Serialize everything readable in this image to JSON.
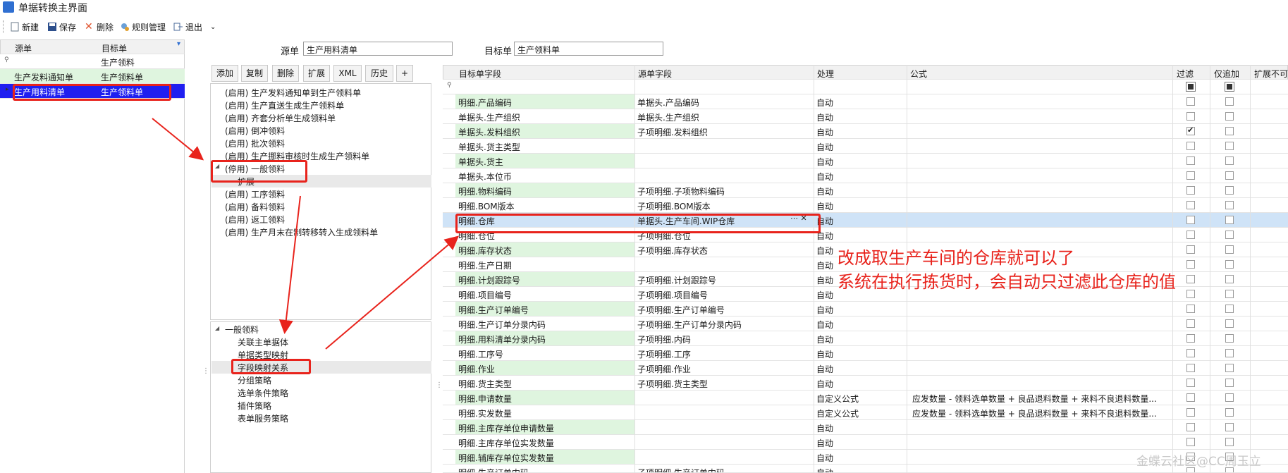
{
  "window": {
    "title": "单据转换主界面"
  },
  "toolbar": {
    "new": "新建",
    "save": "保存",
    "delete": "删除",
    "rules": "规则管理",
    "exit": "退出"
  },
  "left_grid": {
    "headers": [
      "源单",
      "目标单"
    ],
    "filter_target": "生产领料",
    "rows": [
      {
        "source": "生产发料通知单",
        "target": "生产领料单"
      },
      {
        "source": "生产用料清单",
        "target": "生产领料单"
      }
    ]
  },
  "form": {
    "source_label": "源单",
    "source_value": "生产用料清单",
    "target_label": "目标单",
    "target_value": "生产领料单"
  },
  "mid_buttons": [
    "添加",
    "复制",
    "删除",
    "扩展",
    "XML",
    "历史",
    "+"
  ],
  "tree1": [
    "(启用) 生产发料通知单到生产领料单",
    "(启用) 生产直送生成生产领料单",
    "(启用) 齐套分析单生成领料单",
    "(启用) 倒冲领料",
    "(启用) 批次领料",
    "(启用) 生产挪料审核时生成生产领料单",
    "(停用) 一般领料",
    "扩展",
    "(启用) 工序领料",
    "(启用) 备料领料",
    "(启用) 返工领料",
    "(启用) 生产月末在制转移转入生成领料单"
  ],
  "tree2": [
    "一般领料",
    "关联主单据体",
    "单据类型映射",
    "字段映射关系",
    "分组策略",
    "选单条件策略",
    "插件策略",
    "表单服务策略"
  ],
  "right_grid": {
    "headers": [
      "目标单字段",
      "源单字段",
      "处理",
      "公式",
      "过滤",
      "仅追加",
      "扩展不可"
    ],
    "rows": [
      {
        "target": "明细.产品编码",
        "source": "单据头.产品编码",
        "process": "自动",
        "formula": "",
        "filter": false,
        "append": false
      },
      {
        "target": "单据头.生产组织",
        "source": "单据头.生产组织",
        "process": "自动",
        "formula": "",
        "filter": false,
        "append": false
      },
      {
        "target": "单据头.发料组织",
        "source": "子项明细.发料组织",
        "process": "自动",
        "formula": "",
        "filter": true,
        "append": false
      },
      {
        "target": "单据头.货主类型",
        "source": "",
        "process": "自动",
        "formula": "",
        "filter": false,
        "append": false
      },
      {
        "target": "单据头.货主",
        "source": "",
        "process": "自动",
        "formula": "",
        "filter": false,
        "append": false
      },
      {
        "target": "单据头.本位币",
        "source": "",
        "process": "自动",
        "formula": "",
        "filter": false,
        "append": false
      },
      {
        "target": "明细.物料编码",
        "source": "子项明细.子项物料编码",
        "process": "自动",
        "formula": "",
        "filter": false,
        "append": false
      },
      {
        "target": "明细.BOM版本",
        "source": "子项明细.BOM版本",
        "process": "自动",
        "formula": "",
        "filter": false,
        "append": false
      },
      {
        "target": "明细.仓库",
        "source": "单据头.生产车间.WIP仓库",
        "process": "自动",
        "formula": "",
        "filter": false,
        "append": false
      },
      {
        "target": "明细.仓位",
        "source": "子项明细.仓位",
        "process": "自动",
        "formula": "",
        "filter": false,
        "append": false
      },
      {
        "target": "明细.库存状态",
        "source": "子项明细.库存状态",
        "process": "自动",
        "formula": "",
        "filter": false,
        "append": false
      },
      {
        "target": "明细.生产日期",
        "source": "",
        "process": "自动",
        "formula": "",
        "filter": false,
        "append": false
      },
      {
        "target": "明细.计划跟踪号",
        "source": "子项明细.计划跟踪号",
        "process": "自动",
        "formula": "",
        "filter": false,
        "append": false
      },
      {
        "target": "明细.项目编号",
        "source": "子项明细.项目编号",
        "process": "自动",
        "formula": "",
        "filter": false,
        "append": false
      },
      {
        "target": "明细.生产订单编号",
        "source": "子项明细.生产订单编号",
        "process": "自动",
        "formula": "",
        "filter": false,
        "append": false
      },
      {
        "target": "明细.生产订单分录内码",
        "source": "子项明细.生产订单分录内码",
        "process": "自动",
        "formula": "",
        "filter": false,
        "append": false
      },
      {
        "target": "明细.用料清单分录内码",
        "source": "子项明细.内码",
        "process": "自动",
        "formula": "",
        "filter": false,
        "append": false
      },
      {
        "target": "明细.工序号",
        "source": "子项明细.工序",
        "process": "自动",
        "formula": "",
        "filter": false,
        "append": false
      },
      {
        "target": "明细.作业",
        "source": "子项明细.作业",
        "process": "自动",
        "formula": "",
        "filter": false,
        "append": false
      },
      {
        "target": "明细.货主类型",
        "source": "子项明细.货主类型",
        "process": "自动",
        "formula": "",
        "filter": false,
        "append": false
      },
      {
        "target": "明细.申请数量",
        "source": "",
        "process": "自定义公式",
        "formula": "应发数量 - 领料选单数量 + 良品退料数量 + 来料不良退料数量...",
        "filter": false,
        "append": false
      },
      {
        "target": "明细.实发数量",
        "source": "",
        "process": "自定义公式",
        "formula": "应发数量 - 领料选单数量 + 良品退料数量 + 来料不良退料数量...",
        "filter": false,
        "append": false
      },
      {
        "target": "明细.主库存单位申请数量",
        "source": "",
        "process": "自动",
        "formula": "",
        "filter": false,
        "append": false
      },
      {
        "target": "明细.主库存单位实发数量",
        "source": "",
        "process": "自动",
        "formula": "",
        "filter": false,
        "append": false
      },
      {
        "target": "明细.辅库存单位实发数量",
        "source": "",
        "process": "自动",
        "formula": "",
        "filter": false,
        "append": false
      },
      {
        "target": "明细.生产订单内码",
        "source": "子项明细.生产订单内码",
        "process": "自动",
        "formula": "",
        "filter": false,
        "append": false
      }
    ]
  },
  "annotations": {
    "line1": "改成取生产车间的仓库就可以了",
    "line2": "系统在执行拣货时，会自动只过滤此仓库的值"
  },
  "watermark": "金蝶云社区@CC周玉立",
  "colors": {
    "accent_red": "#e8231c",
    "selection_blue": "#1f1ff0",
    "row_green": "#dff5df"
  }
}
